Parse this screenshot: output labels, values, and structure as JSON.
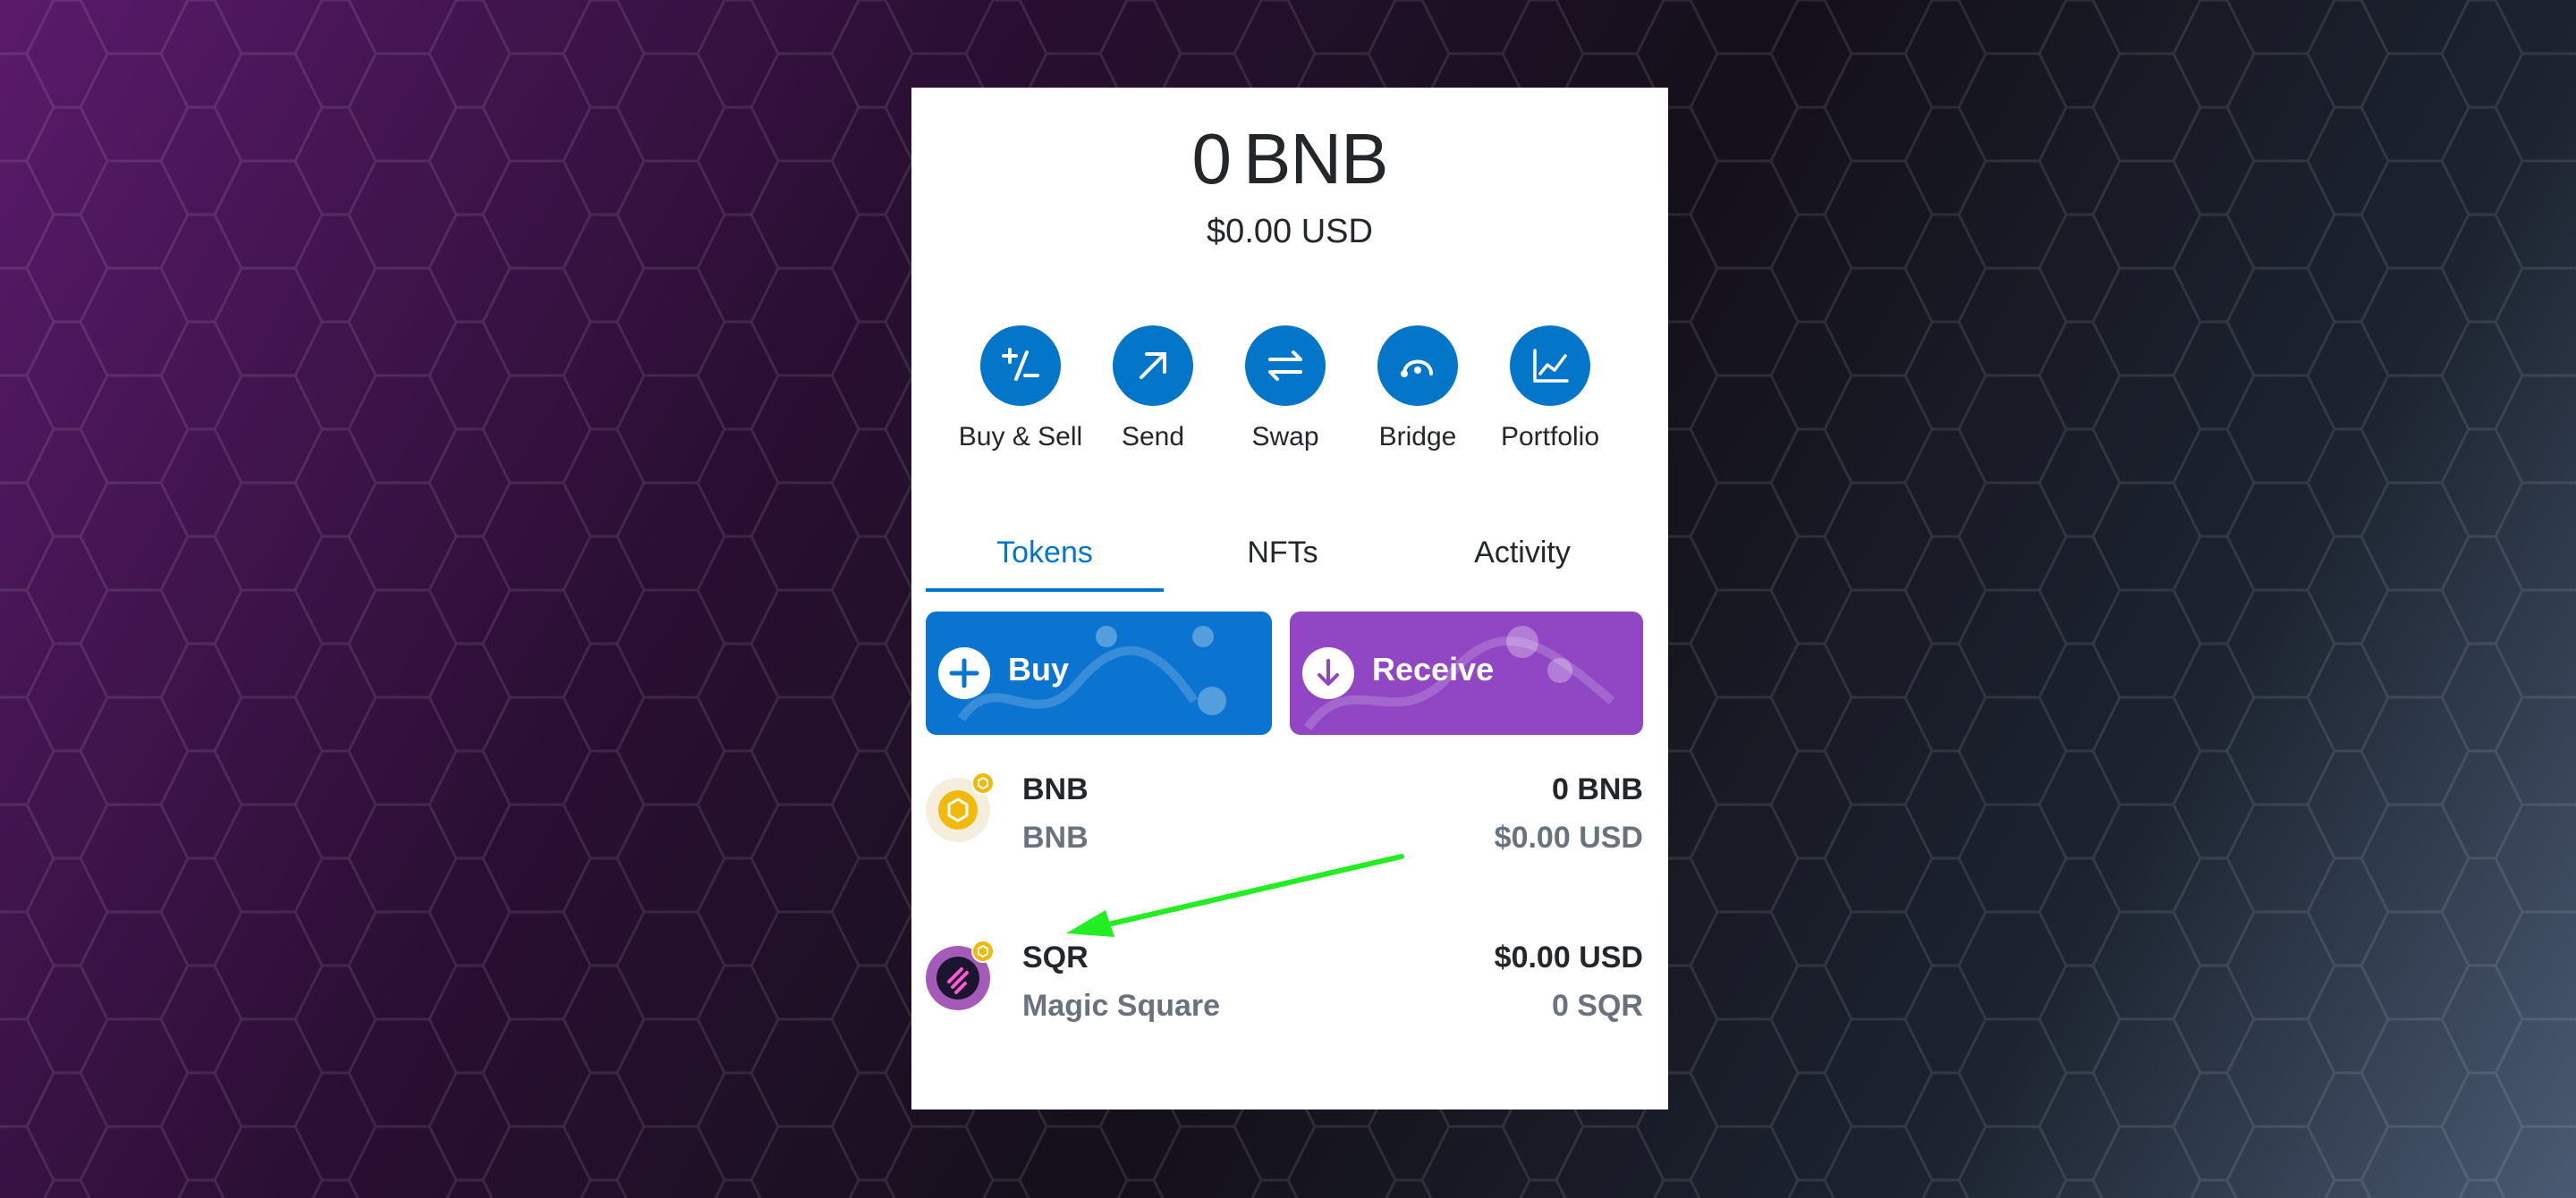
{
  "balance": {
    "amount": "0",
    "unit": "BNB",
    "fiat": "$0.00 USD"
  },
  "actions": [
    {
      "label": "Buy & Sell",
      "icon": "plus-minus-icon"
    },
    {
      "label": "Send",
      "icon": "arrow-up-right-icon"
    },
    {
      "label": "Swap",
      "icon": "swap-arrows-icon"
    },
    {
      "label": "Bridge",
      "icon": "bridge-icon"
    },
    {
      "label": "Portfolio",
      "icon": "chart-icon"
    }
  ],
  "tabs": [
    {
      "label": "Tokens",
      "active": true
    },
    {
      "label": "NFTs",
      "active": false
    },
    {
      "label": "Activity",
      "active": false
    }
  ],
  "promos": {
    "buy": {
      "label": "Buy",
      "icon": "plus-icon",
      "color": "#0b74d0"
    },
    "receive": {
      "label": "Receive",
      "icon": "arrow-down-icon",
      "color": "#9146c4"
    }
  },
  "tokens": [
    {
      "symbol": "BNB",
      "name": "BNB",
      "right_top": "0 BNB",
      "right_bottom": "$0.00 USD"
    },
    {
      "symbol": "SQR",
      "name": "Magic Square",
      "right_top": "$0.00 USD",
      "right_bottom": "0 SQR"
    }
  ],
  "colors": {
    "accent": "#0376c9",
    "annotation_arrow": "#22ee22"
  }
}
